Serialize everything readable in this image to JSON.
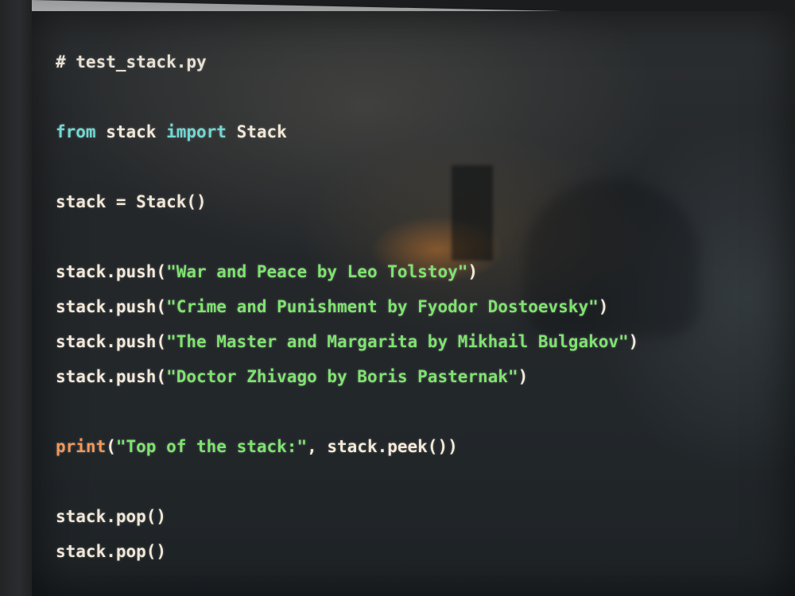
{
  "editor": {
    "lines": [
      {
        "kind": "comment",
        "text": "# test_stack.py"
      },
      {
        "kind": "blank",
        "text": ""
      },
      {
        "kind": "import",
        "from_kw": "from",
        "module": " stack ",
        "import_kw": "import",
        "name": " Stack"
      },
      {
        "kind": "blank",
        "text": ""
      },
      {
        "kind": "assign",
        "text": "stack = Stack()"
      },
      {
        "kind": "blank",
        "text": ""
      },
      {
        "kind": "push",
        "prefix": "stack.push(",
        "string": "\"War and Peace by Leo Tolstoy\"",
        "suffix": ")"
      },
      {
        "kind": "push",
        "prefix": "stack.push(",
        "string": "\"Crime and Punishment by Fyodor Dostoevsky\"",
        "suffix": ")"
      },
      {
        "kind": "push",
        "prefix": "stack.push(",
        "string": "\"The Master and Margarita by Mikhail Bulgakov\"",
        "suffix": ")"
      },
      {
        "kind": "push",
        "prefix": "stack.push(",
        "string": "\"Doctor Zhivago by Boris Pasternak\"",
        "suffix": ")"
      },
      {
        "kind": "blank",
        "text": ""
      },
      {
        "kind": "print",
        "func": "print",
        "open": "(",
        "string": "\"Top of the stack:\"",
        "rest": ", stack.peek())"
      },
      {
        "kind": "blank",
        "text": ""
      },
      {
        "kind": "pop",
        "text": "stack.pop()"
      },
      {
        "kind": "pop",
        "text": "stack.pop()"
      }
    ]
  },
  "colors": {
    "comment": "#e7e0d2",
    "keyword": "#6fd9d3",
    "string": "#7ee36e",
    "builtin": "#f0975a",
    "default": "#f1e7d6"
  }
}
